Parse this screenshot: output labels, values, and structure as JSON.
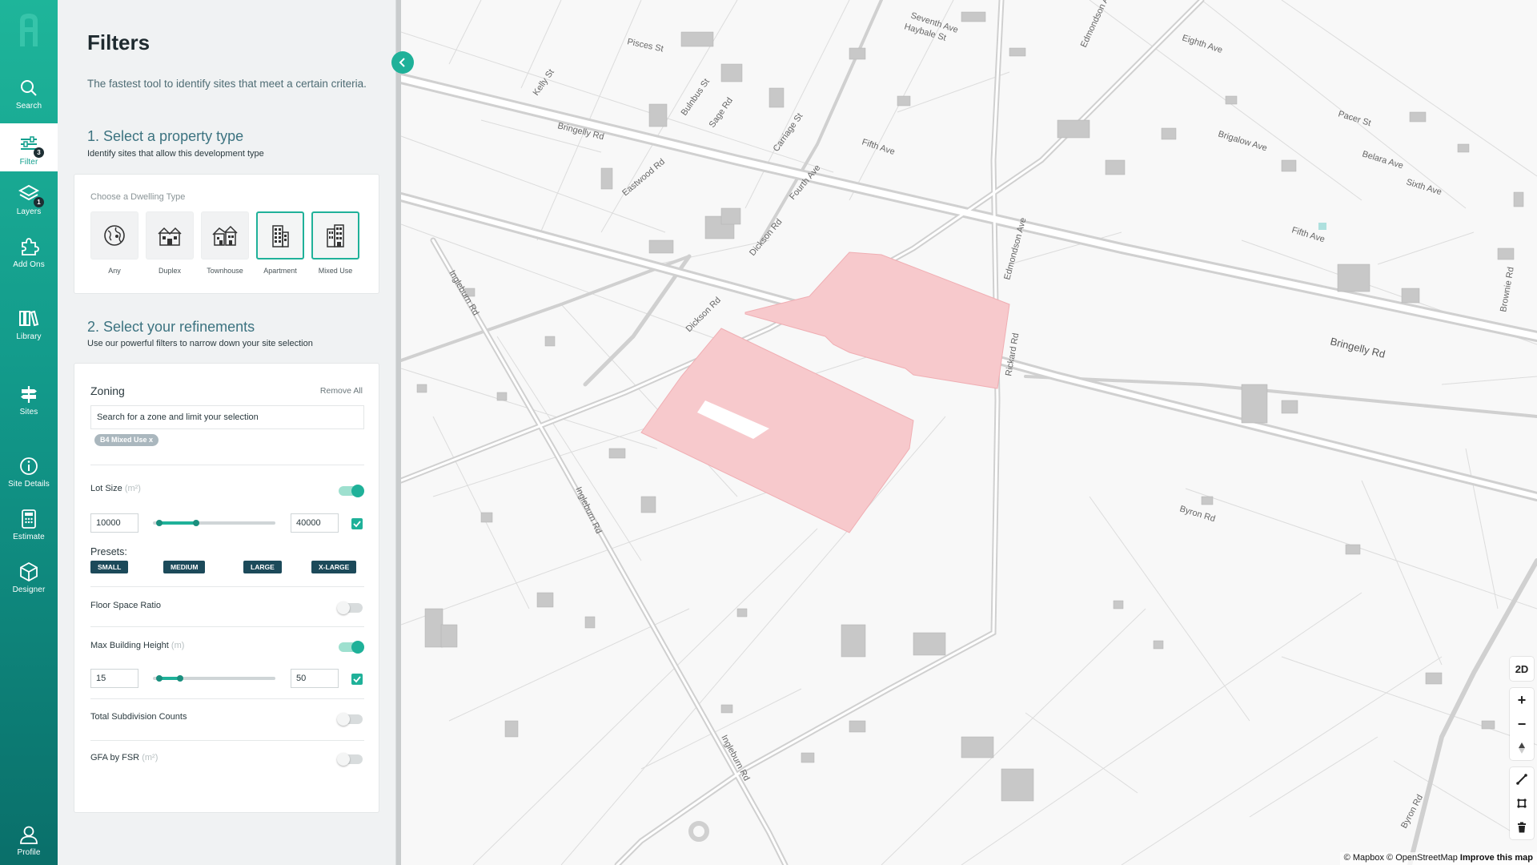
{
  "nav": {
    "items": [
      {
        "label": "Search",
        "icon": "search-icon"
      },
      {
        "label": "Filter",
        "icon": "filter-icon",
        "badge": "3"
      },
      {
        "label": "Layers",
        "icon": "layers-icon",
        "badge": "1"
      },
      {
        "label": "Add Ons",
        "icon": "puzzle-icon"
      },
      {
        "label": "Library",
        "icon": "library-icon"
      },
      {
        "label": "Sites",
        "icon": "sites-icon"
      },
      {
        "label": "Site Details",
        "icon": "info-icon"
      },
      {
        "label": "Estimate",
        "icon": "calculator-icon"
      },
      {
        "label": "Designer",
        "icon": "cube-icon"
      },
      {
        "label": "Profile",
        "icon": "user-icon"
      }
    ],
    "active": "Filter"
  },
  "panel": {
    "title": "Filters",
    "description": "The fastest tool to identify sites that meet a certain criteria.",
    "section1": {
      "title": "1. Select a property type",
      "subtitle": "Identify sites that allow this development type"
    },
    "dwelling": {
      "label": "Choose a Dwelling Type",
      "options": [
        {
          "name": "Any",
          "icon": "globe-icon",
          "selected": false
        },
        {
          "name": "Duplex",
          "icon": "duplex-icon",
          "selected": false
        },
        {
          "name": "Townhouse",
          "icon": "townhouse-icon",
          "selected": false
        },
        {
          "name": "Apartment",
          "icon": "apartment-icon",
          "selected": true
        },
        {
          "name": "Mixed Use",
          "icon": "mixed-use-icon",
          "selected": true
        }
      ]
    },
    "section2": {
      "title": "2. Select your refinements",
      "subtitle": "Use our powerful filters to narrow down your site selection"
    },
    "zoning": {
      "title": "Zoning",
      "remove_all": "Remove All",
      "search_placeholder": "Search for a zone and limit your selection",
      "chips": [
        "B4 Mixed Use x"
      ]
    },
    "lot_size": {
      "label": "Lot Size",
      "unit": "(m²)",
      "enabled": true,
      "min": "10000",
      "max": "40000",
      "slider_low_fraction": 0.05,
      "slider_high_fraction": 0.35,
      "presets_label": "Presets:",
      "presets": [
        "SMALL",
        "MEDIUM",
        "LARGE",
        "X-LARGE"
      ]
    },
    "floor_space_ratio": {
      "label": "Floor Space Ratio",
      "enabled": false
    },
    "max_building_height": {
      "label": "Max Building Height",
      "unit": "(m)",
      "enabled": true,
      "min": "15",
      "max": "50",
      "slider_low_fraction": 0.05,
      "slider_high_fraction": 0.22
    },
    "total_subdivision": {
      "label": "Total Subdivision Counts",
      "enabled": false
    },
    "gfa_by_fsr": {
      "label": "GFA by FSR",
      "unit": "(m²)",
      "enabled": false
    }
  },
  "map": {
    "roads": [
      "Pisces St",
      "Seventh Ave",
      "Haybale St",
      "Edmondson Ave",
      "Eighth Ave",
      "Kelly St",
      "Bringelly Rd",
      "Bulnbus St",
      "Sage Rd",
      "Carriage St",
      "Fifth Ave",
      "Fourth Ave",
      "Brigalow Ave",
      "Pacer St",
      "Belara Ave",
      "Sixth Ave",
      "Fifth Ave",
      "Eastwood Rd",
      "Dickson Rd",
      "Dickson Rd",
      "Ingleburn Rd",
      "Rickard Rd",
      "Edmondson Ave",
      "Brownie Rd",
      "Bringelly Rd",
      "Byron Rd",
      "Ingleburn Rd",
      "Ingleburn Rd",
      "Byron Rd"
    ],
    "controls": {
      "view_mode": "2D",
      "zoom_in": "+",
      "zoom_out": "−"
    },
    "attribution": {
      "mapbox": "© Mapbox",
      "osm": "© OpenStreetMap",
      "improve": "Improve this map"
    }
  },
  "colors": {
    "accent": "#1fb199",
    "highlight": "#f7c9cc",
    "nav_dark": "#1c4a5a"
  }
}
